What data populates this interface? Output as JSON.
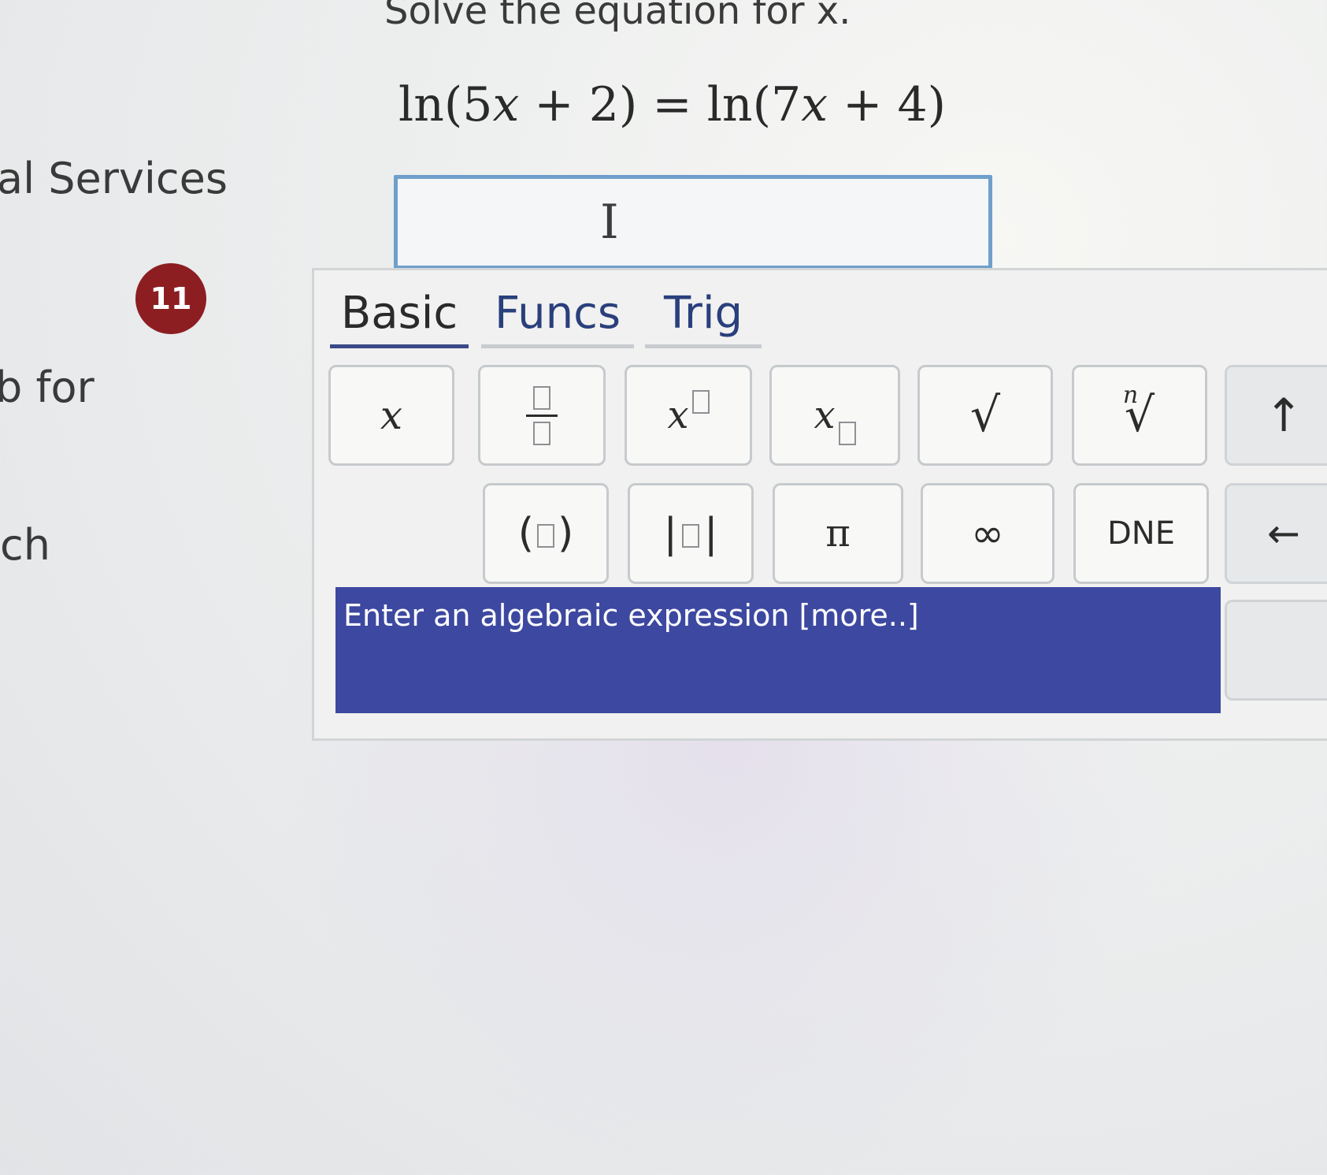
{
  "sidebar": {
    "services_fragment": "al Services",
    "for_fragment": "b for",
    "ch_fragment": "ch",
    "badge_count": "11"
  },
  "question": {
    "prompt": "Solve the equation for x.",
    "equation": {
      "lhs_func": "ln",
      "lhs_arg_coef": "5",
      "lhs_arg_var": "x",
      "lhs_arg_rest": " + 2",
      "equals": "=",
      "rhs_func": "ln",
      "rhs_arg_coef": "7",
      "rhs_arg_var": "x",
      "rhs_arg_rest": " + 4"
    },
    "answer_value": ""
  },
  "keyboard": {
    "tabs": [
      {
        "label": "Basic",
        "active": true
      },
      {
        "label": "Funcs",
        "active": false
      },
      {
        "label": "Trig",
        "active": false
      }
    ],
    "keys": {
      "x": "x",
      "sqrt": "√",
      "nthroot_index": "n",
      "nthroot_symbol": "√",
      "up": "↑",
      "parens_open": "(",
      "parens_close": ")",
      "abs_bar": "|",
      "pi": "π",
      "infinity": "∞",
      "dne": "DNE",
      "left": "←",
      "super_base": "x",
      "sub_base": "x"
    },
    "hint_text": "Enter an algebraic expression ",
    "hint_more": "[more..]"
  },
  "icons": {
    "text_cursor": "I-beam-cursor-icon"
  },
  "colors": {
    "hint_bar": "#3d48a0",
    "badge": "#8c1e22",
    "answer_border": "#6f9fcb"
  }
}
